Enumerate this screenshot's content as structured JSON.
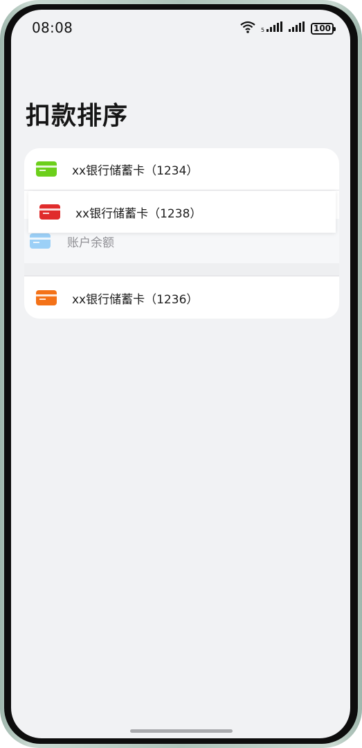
{
  "status_bar": {
    "time": "08:08",
    "battery": "100",
    "icons": [
      "wifi-icon",
      "signal-icon",
      "signal-icon",
      "battery-icon"
    ]
  },
  "page": {
    "title": "扣款排序"
  },
  "payment_methods": [
    {
      "label": "xx银行储蓄卡（1234）",
      "icon": "bank-card-icon",
      "color": "#6ccf1b"
    },
    {
      "label": "xx银行储蓄卡（1238）",
      "icon": "bank-card-icon",
      "color": "#e02b2b"
    },
    {
      "label": "账户余额",
      "icon": "bank-card-icon",
      "color": "#7fc3f7"
    },
    {
      "label": "xx银行储蓄卡（1236）",
      "icon": "bank-card-icon",
      "color": "#f47218"
    }
  ]
}
